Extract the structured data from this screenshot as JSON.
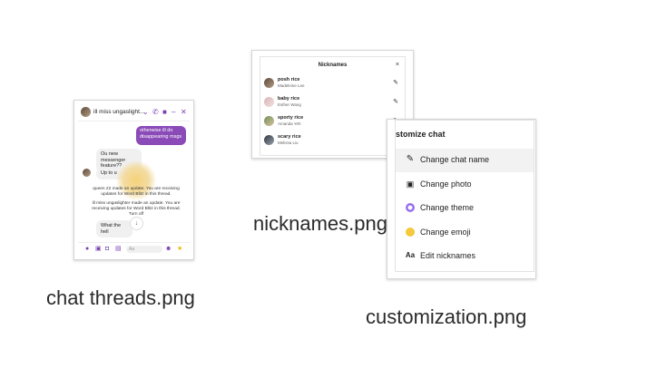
{
  "files": {
    "chat": {
      "filename": "chat threads.png"
    },
    "nicknames": {
      "filename": "nicknames.png"
    },
    "customization": {
      "filename": "customization.png"
    }
  },
  "chat_preview": {
    "title": "ill miss ungaslight...",
    "outgoing": "otherwise ill do disappearing msgs",
    "incoming_1": "Ou new messenger feature??",
    "incoming_2": "Up to u",
    "system_1": "queen 22 made an update. You are receiving updates for Word Blitz in this thread.",
    "system_2": "ill miss ungaslighter made an update. You are receiving updates for Word Blitz in this thread. Turn off",
    "incoming_3": "What the hell",
    "composer_placeholder": "Aa",
    "accent_color": "#8a4ab8"
  },
  "nicknames_preview": {
    "title": "Nicknames",
    "close_glyph": "×",
    "rows": [
      {
        "nickname": "posh rice",
        "name": "Madeleine Lee"
      },
      {
        "nickname": "baby rice",
        "name": "Esther Wang"
      },
      {
        "nickname": "sporty rice",
        "name": "Amanda Yeh"
      },
      {
        "nickname": "scary rice",
        "name": "Melissa Liu"
      }
    ]
  },
  "customization_preview": {
    "title": "stomize chat",
    "items": [
      {
        "label": "Change chat name",
        "icon": "pencil-icon"
      },
      {
        "label": "Change photo",
        "icon": "image-icon"
      },
      {
        "label": "Change theme",
        "icon": "theme-icon"
      },
      {
        "label": "Change emoji",
        "icon": "emoji-icon"
      },
      {
        "label": "Edit nicknames",
        "icon": "text-aa-icon",
        "glyph": "Aa"
      }
    ]
  }
}
